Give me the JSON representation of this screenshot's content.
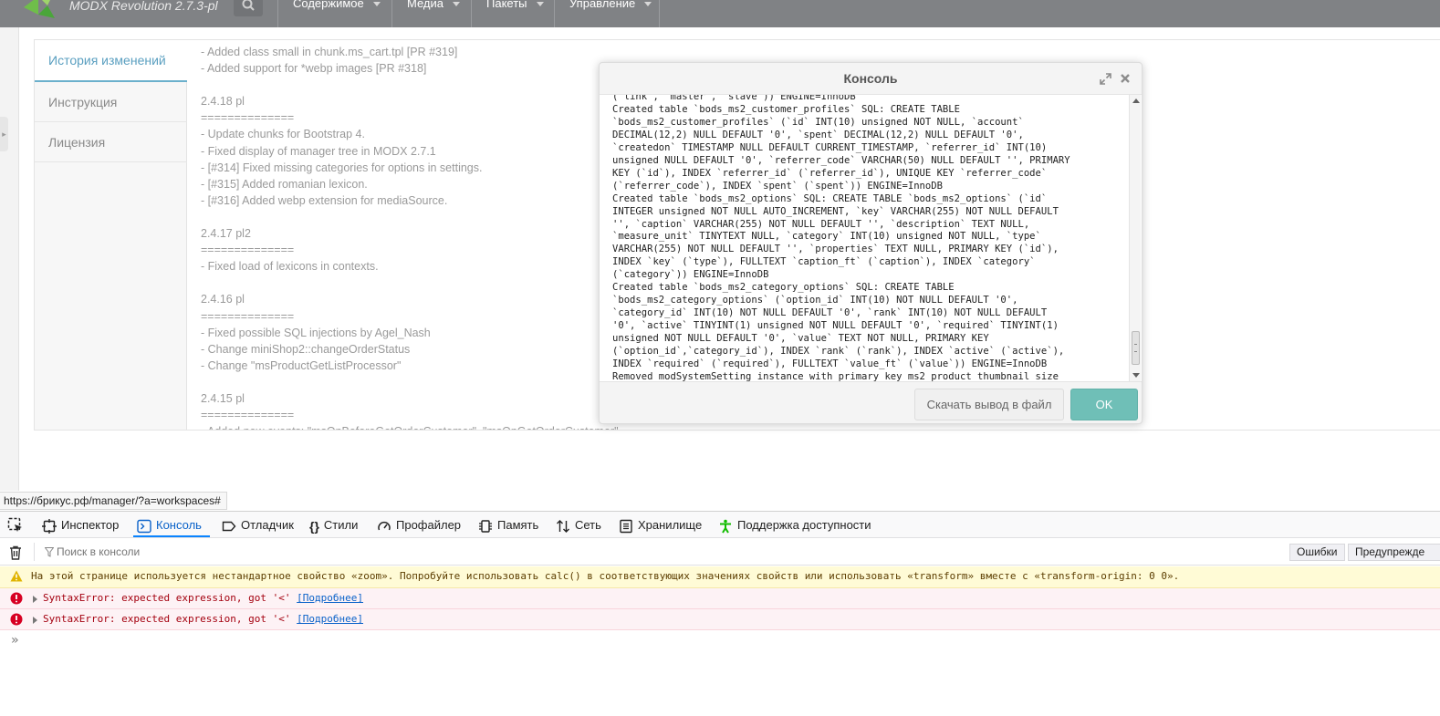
{
  "app": {
    "brand": "MODX Revolution 2.7.3-pl",
    "nav": [
      {
        "label": "Содержимое"
      },
      {
        "label": "Медиа"
      },
      {
        "label": "Пакеты"
      },
      {
        "label": "Управление"
      }
    ]
  },
  "panel": {
    "tabs": [
      {
        "label": "История изменений",
        "active": true
      },
      {
        "label": "Инструкция"
      },
      {
        "label": "Лицензия"
      }
    ],
    "changelog": [
      "- Added class small in chunk.ms_cart.tpl [PR #319]",
      "- Added support for *webp images [PR #318]",
      "",
      "2.4.18 pl",
      "==============",
      "- Update chunks for Bootstrap 4.",
      "- Fixed display of manager tree in MODX 2.7.1",
      "- [#314] Fixed missing categories for options in settings.",
      "- [#315] Added romanian lexicon.",
      "- [#316] Added webp extension for mediaSource.",
      "",
      "2.4.17 pl2",
      "==============",
      "- Fixed load of lexicons in contexts.",
      "",
      "2.4.16 pl",
      "==============",
      "- Fixed possible SQL injections by Agel_Nash",
      "- Change miniShop2::changeOrderStatus",
      "- Change \"msProductGetListProcessor\"",
      "",
      "2.4.15 pl",
      "==============",
      "- Added new events: \"msOnBeforeGetOrderCustomer\", \"msOnGetOrderCustomer\""
    ]
  },
  "dialog": {
    "title": "Консоль",
    "console_lines": [
      "(`link`, `master`, `slave`)) ENGINE=InnoDB",
      "Created table `bods_ms2_customer_profiles` SQL: CREATE TABLE",
      "`bods_ms2_customer_profiles` (`id` INT(10) unsigned NOT NULL, `account`",
      "DECIMAL(12,2) NULL DEFAULT '0', `spent` DECIMAL(12,2) NULL DEFAULT '0',",
      "`createdon` TIMESTAMP NULL DEFAULT CURRENT_TIMESTAMP, `referrer_id` INT(10)",
      "unsigned NULL DEFAULT '0', `referrer_code` VARCHAR(50) NULL DEFAULT '', PRIMARY",
      "KEY (`id`), INDEX `referrer_id` (`referrer_id`), UNIQUE KEY `referrer_code`",
      "(`referrer_code`), INDEX `spent` (`spent`)) ENGINE=InnoDB",
      "Created table `bods_ms2_options` SQL: CREATE TABLE `bods_ms2_options` (`id`",
      "INTEGER unsigned NOT NULL AUTO_INCREMENT, `key` VARCHAR(255) NOT NULL DEFAULT",
      "'', `caption` VARCHAR(255) NOT NULL DEFAULT '', `description` TEXT NULL,",
      "`measure_unit` TINYTEXT NULL, `category` INT(10) unsigned NOT NULL, `type`",
      "VARCHAR(255) NOT NULL DEFAULT '', `properties` TEXT NULL, PRIMARY KEY (`id`),",
      "INDEX `key` (`type`), FULLTEXT `caption_ft` (`caption`), INDEX `category`",
      "(`category`)) ENGINE=InnoDB",
      "Created table `bods_ms2_category_options` SQL: CREATE TABLE",
      "`bods_ms2_category_options` (`option_id` INT(10) NOT NULL DEFAULT '0',",
      "`category_id` INT(10) NOT NULL DEFAULT '0', `rank` INT(10) NOT NULL DEFAULT",
      "'0', `active` TINYINT(1) unsigned NOT NULL DEFAULT '0', `required` TINYINT(1)",
      "unsigned NOT NULL DEFAULT '0', `value` TEXT NOT NULL, PRIMARY KEY",
      "(`option_id`,`category_id`), INDEX `rank` (`rank`), INDEX `active` (`active`),",
      "INDEX `required` (`required`), FULLTEXT `value_ft` (`value`)) ENGINE=InnoDB",
      "Removed modSystemSetting instance with primary key ms2_product_thumbnail_size"
    ],
    "download_label": "Скачать вывод в файл",
    "ok_label": "OK"
  },
  "status_url": "https://брикус.рф/manager/?a=workspaces#",
  "devtools": {
    "tabs": [
      {
        "label": "Инспектор",
        "icon": "inspector-icon"
      },
      {
        "label": "Консоль",
        "icon": "console-icon",
        "active": true
      },
      {
        "label": "Отладчик",
        "icon": "debugger-icon"
      },
      {
        "label": "Стили",
        "icon": "style-editor-icon"
      },
      {
        "label": "Профайлер",
        "icon": "performance-icon"
      },
      {
        "label": "Память",
        "icon": "memory-icon"
      },
      {
        "label": "Сеть",
        "icon": "network-icon"
      },
      {
        "label": "Хранилище",
        "icon": "storage-icon"
      },
      {
        "label": "Поддержка доступности",
        "icon": "accessibility-icon"
      }
    ],
    "filter_placeholder": "Поиск в консоли",
    "filter_buttons": [
      "Ошибки",
      "Предупрежде"
    ],
    "warning": "На этой странице используется нестандартное свойство «zoom». Попробуйте использовать calc() в соответствующих значениях свойств или использовать «transform» вместе с «transform-origin: 0 0».",
    "errors": [
      {
        "text": "SyntaxError: expected expression, got '<'",
        "link": "[Подробнее]"
      },
      {
        "text": "SyntaxError: expected expression, got '<'",
        "link": "[Подробнее]"
      }
    ],
    "prompt": "»"
  },
  "colors": {
    "topbar": "#808285",
    "active_tab": "#5a9fc0",
    "ok_button": "#6fbfb7",
    "devtools_active": "#0a62c9",
    "warning_bg": "#fffbd6",
    "error_bg": "#fdf2f5"
  }
}
